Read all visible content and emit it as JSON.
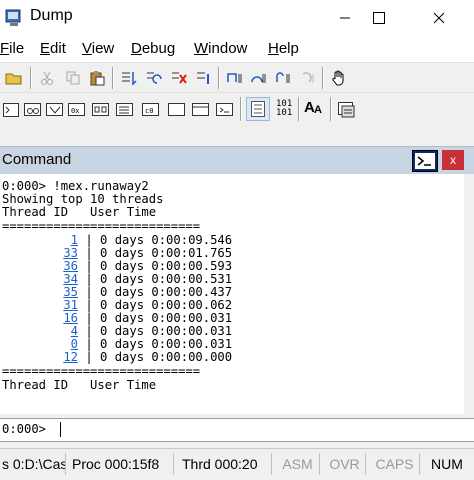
{
  "window": {
    "title": "Dump"
  },
  "menu": [
    {
      "ul": "F",
      "rest": "ile"
    },
    {
      "ul": "E",
      "rest": "dit"
    },
    {
      "ul": "V",
      "rest": "iew"
    },
    {
      "ul": "D",
      "rest": "ebug"
    },
    {
      "ul": "W",
      "rest": "indow"
    },
    {
      "ul": "H",
      "rest": "elp"
    }
  ],
  "toolbar2": {
    "hex_top": "101",
    "hex_bottom": "101",
    "font_label": "A"
  },
  "command": {
    "title": "Command",
    "close_glyph": "x",
    "output": {
      "command_line": "0:000> !mex.runaway2",
      "summary": "Showing top 10 threads",
      "header": "Thread ID   User Time",
      "divider": "===========================",
      "rows": [
        {
          "id": "1",
          "time": "0 days 0:00:09.546"
        },
        {
          "id": "33",
          "time": "0 days 0:00:01.765"
        },
        {
          "id": "36",
          "time": "0 days 0:00:00.593"
        },
        {
          "id": "34",
          "time": "0 days 0:00:00.531"
        },
        {
          "id": "35",
          "time": "0 days 0:00:00.437"
        },
        {
          "id": "31",
          "time": "0 days 0:00:00.062"
        },
        {
          "id": "16",
          "time": "0 days 0:00:00.031"
        },
        {
          "id": "4",
          "time": "0 days 0:00:00.031"
        },
        {
          "id": "0",
          "time": "0 days 0:00:00.031"
        },
        {
          "id": "12",
          "time": "0 days 0:00:00.000"
        }
      ],
      "footer_header": "Thread ID   User Time"
    },
    "prompt": "0:000>"
  },
  "status": {
    "dump": "s 0:D:\\Cas",
    "proc": "Proc 000:15f8",
    "thrd": "Thrd 000:20",
    "asm": "ASM",
    "ovr": "OVR",
    "caps": "CAPS",
    "num": "NUM"
  },
  "colors": {
    "link": "#1f5fcf",
    "command_titlebar": "#c9d4e2",
    "close_red": "#c8303a"
  }
}
